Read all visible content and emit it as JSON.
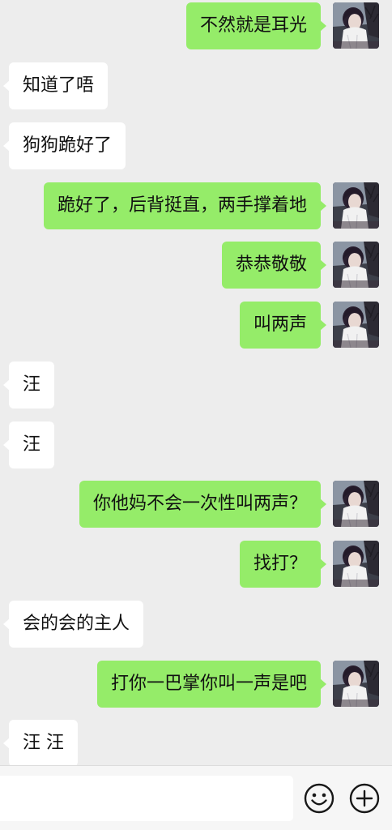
{
  "messages": [
    {
      "direction": "out",
      "text": "不然就是耳光"
    },
    {
      "direction": "in",
      "text": "知道了唔"
    },
    {
      "direction": "in",
      "text": "狗狗跪好了"
    },
    {
      "direction": "out",
      "text": "跪好了，后背挺直，两手撑着地"
    },
    {
      "direction": "out",
      "text": "恭恭敬敬"
    },
    {
      "direction": "out",
      "text": "叫两声"
    },
    {
      "direction": "in",
      "text": "汪"
    },
    {
      "direction": "in",
      "text": "汪"
    },
    {
      "direction": "out",
      "text": "你他妈不会一次性叫两声？"
    },
    {
      "direction": "out",
      "text": "找打？"
    },
    {
      "direction": "in",
      "text": "会的会的主人"
    },
    {
      "direction": "out",
      "text": "打你一巴掌你叫一声是吧"
    },
    {
      "direction": "in",
      "text": "汪 汪"
    }
  ],
  "input_bar": {
    "value": "",
    "emoji_icon": "smiley-face-icon",
    "more_icon": "plus-circle-icon"
  },
  "colors": {
    "background": "#ededed",
    "outgoing_bubble": "#95ec69",
    "incoming_bubble": "#ffffff",
    "input_bar": "#f6f6f6"
  }
}
